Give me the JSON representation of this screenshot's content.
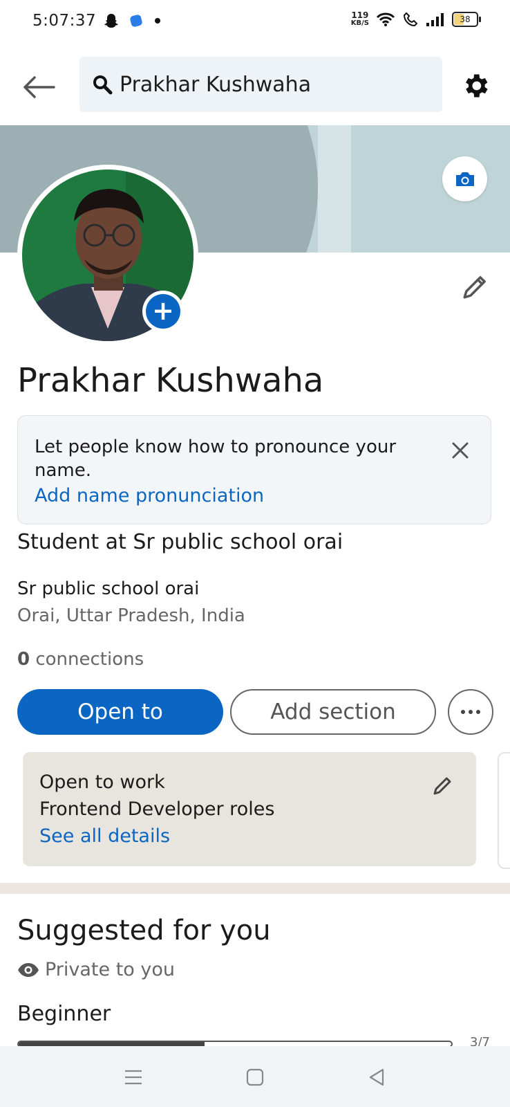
{
  "status_bar": {
    "time": "5:07:37",
    "net_speed": "119",
    "net_unit": "KB/S",
    "battery": "38"
  },
  "top_bar": {
    "search_value": "Prakhar Kushwaha"
  },
  "profile": {
    "name": "Prakhar Kushwaha",
    "headline": "Student at Sr public school orai",
    "company": "Sr public school orai",
    "location": "Orai, Uttar Pradesh, India",
    "connections_count": "0",
    "connections_label": "connections"
  },
  "pronunciation": {
    "text": "Let people know how to pronounce your name.",
    "link": "Add name pronunciation"
  },
  "actions": {
    "open_to": "Open to",
    "add_section": "Add section"
  },
  "open_to_work": {
    "title": "Open to work",
    "roles": "Frontend Developer roles",
    "link": "See all details"
  },
  "suggested": {
    "title": "Suggested for you",
    "private_label": "Private to you",
    "level": "Beginner",
    "progress": "3/7",
    "progress_fraction": 0.43
  },
  "colors": {
    "accent": "#0a66c2",
    "banner": "#bfd4d8",
    "otw_card": "#e8e4de"
  },
  "icons": {
    "back": "arrow-left-icon",
    "search": "search-icon",
    "settings": "gear-icon",
    "camera": "camera-icon",
    "edit": "pencil-icon",
    "close": "close-icon",
    "more": "more-horizontal-icon",
    "eye": "eye-icon"
  }
}
